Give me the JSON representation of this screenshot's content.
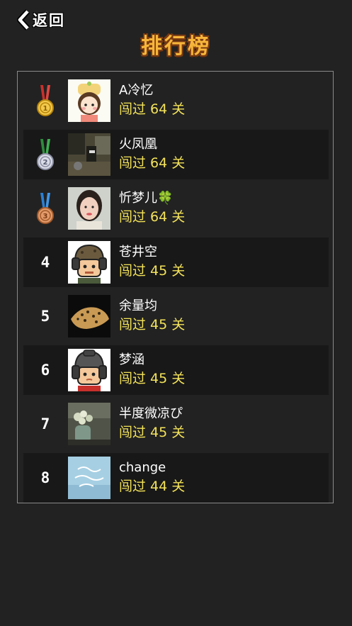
{
  "header": {
    "back_label": "返回",
    "title": "排行榜"
  },
  "colors": {
    "background": "#222222",
    "score_text": "#f3e25a",
    "title_fill": "#f7b63a",
    "title_outline": "#7a3a12"
  },
  "leaderboard": [
    {
      "rank": "1",
      "medal": "gold-medal",
      "name": "A冷忆",
      "score": "闯过 64 关"
    },
    {
      "rank": "2",
      "medal": "silver-medal",
      "name": "火凤凰",
      "score": "闯过 64 关"
    },
    {
      "rank": "3",
      "medal": "bronze-medal",
      "name": "忻梦儿🍀",
      "score": "闯过 64 关"
    },
    {
      "rank": "4",
      "name": "苍井空",
      "score": "闯过 45 关"
    },
    {
      "rank": "5",
      "name": "余量均",
      "score": "闯过 45 关"
    },
    {
      "rank": "6",
      "name": "梦涵",
      "score": "闯过 45 关"
    },
    {
      "rank": "7",
      "name": "半度微凉ぴ",
      "score": "闯过 45 关"
    },
    {
      "rank": "8",
      "name": "change",
      "score": "闯过 44 关"
    }
  ]
}
